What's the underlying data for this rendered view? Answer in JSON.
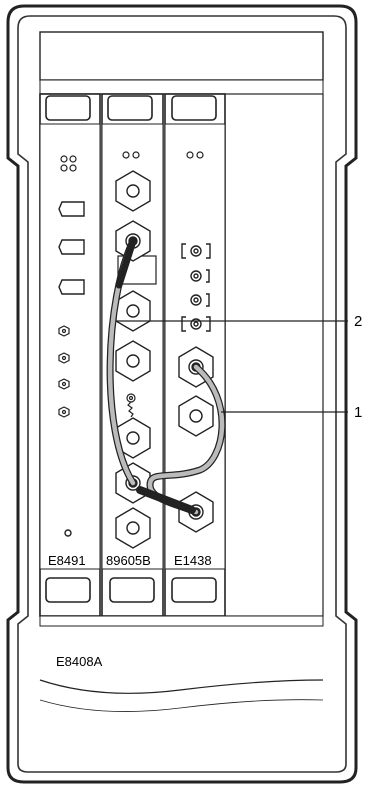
{
  "chassis": {
    "model": "E8408A"
  },
  "modules": [
    {
      "label": "E8491"
    },
    {
      "label": "89605B"
    },
    {
      "label": "E1438"
    }
  ],
  "callouts": [
    {
      "number": "2"
    },
    {
      "number": "1"
    }
  ]
}
